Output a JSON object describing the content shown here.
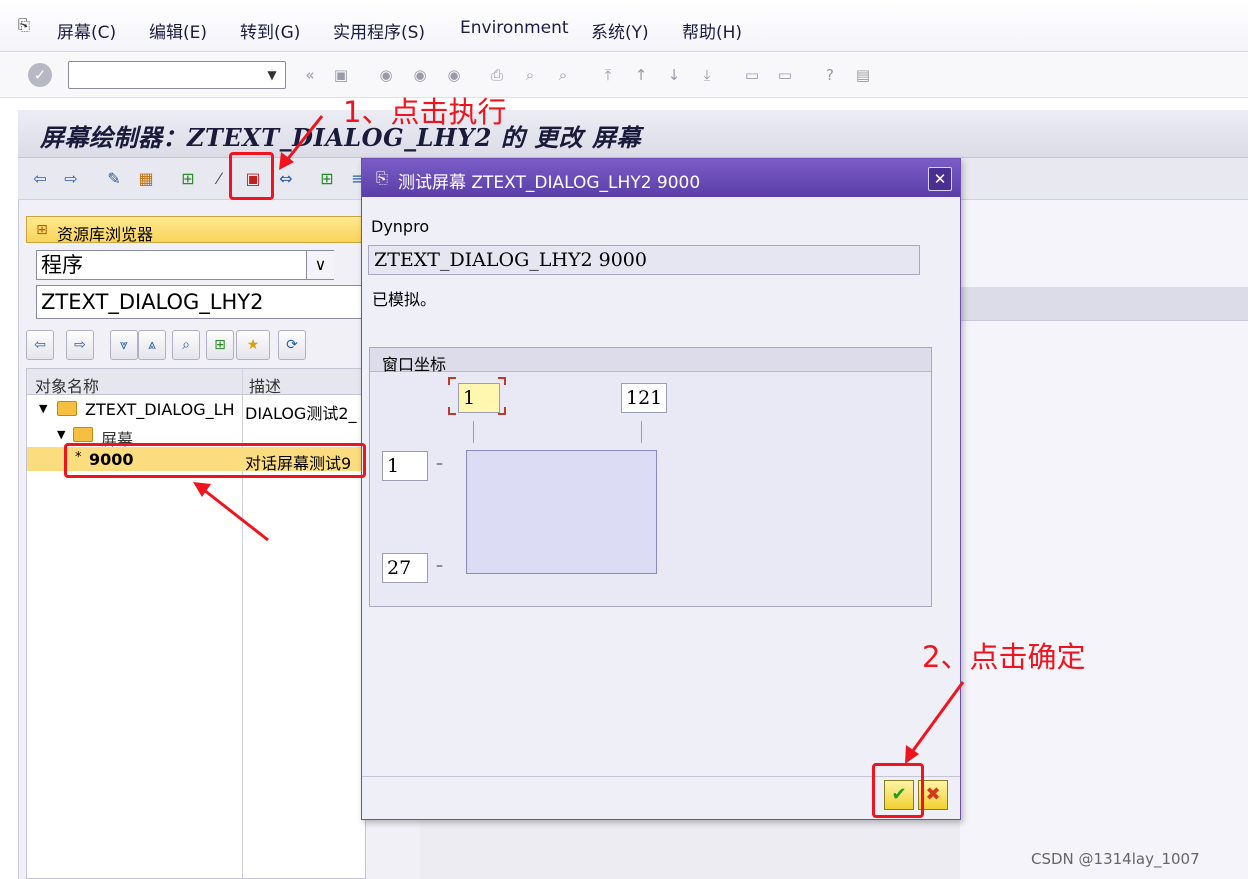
{
  "menu": {
    "items": [
      "屏幕(C)",
      "编辑(E)",
      "转到(G)",
      "实用程序(S)",
      "Environment",
      "系统(Y)",
      "帮助(H)"
    ]
  },
  "page": {
    "title": "屏幕绘制器：ZTEXT_DIALOG_LHY2 的 更改 屏幕"
  },
  "repository": {
    "title": "资源库浏览器",
    "object_type": "程序",
    "object_name": "ZTEXT_DIALOG_LHY2",
    "columns": [
      "对象名称",
      "描述"
    ],
    "tree": [
      {
        "name": "ZTEXT_DIALOG_LH",
        "desc": "DIALOG测试2_"
      },
      {
        "name": "屏幕",
        "desc": ""
      },
      {
        "name": "9000",
        "desc": "对话屏幕测试9",
        "marker": "*"
      }
    ]
  },
  "dialog": {
    "title": "测试屏幕 ZTEXT_DIALOG_LHY2 9000",
    "dynpro_label": "Dynpro",
    "dynpro_value": "ZTEXT_DIALOG_LHY2 9000",
    "status": "已模拟。",
    "coords_title": "窗口坐标",
    "col_start": "1",
    "col_end": "121",
    "row_start": "1",
    "row_end": "27"
  },
  "annotations": {
    "step1": "1、点击执行",
    "step2": "2、点击确定"
  },
  "watermark": "CSDN @1314lay_1007",
  "icons": {
    "toolbar": [
      "check-icon",
      "save-icon",
      "back-icon",
      "exit-icon",
      "cancel-icon",
      "print-icon",
      "find-icon",
      "find-next-icon",
      "first-page-icon",
      "prev-page-icon",
      "next-page-icon",
      "last-page-icon",
      "create-session-icon",
      "shortcut-icon",
      "help-icon",
      "layout-icon"
    ],
    "colors": {
      "accent": "#6d4fb3",
      "annotation": "#f0141e",
      "selection": "#fbdc7e"
    }
  }
}
